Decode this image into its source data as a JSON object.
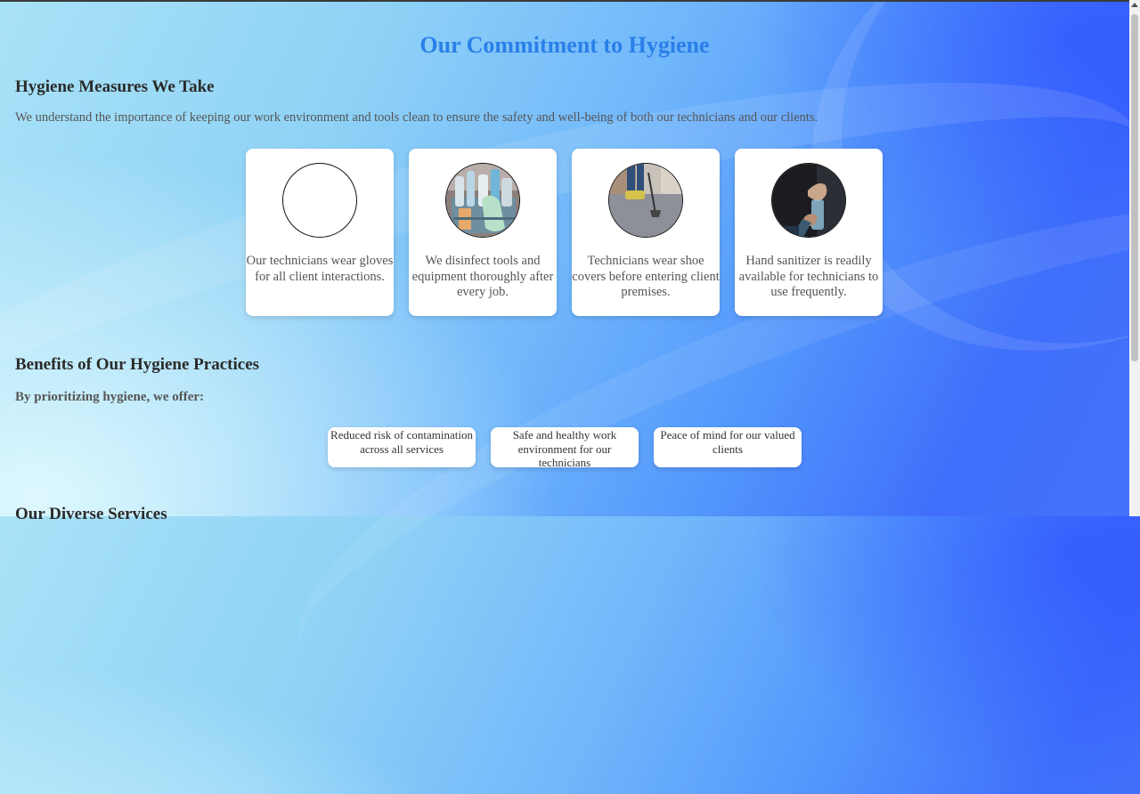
{
  "page": {
    "title": "Our Commitment to Hygiene"
  },
  "measures": {
    "heading": "Hygiene Measures We Take",
    "intro": "We understand the importance of keeping our work environment and tools clean to ensure the safety and well-being of both our technicians and our clients.",
    "cards": [
      {
        "image": "empty-image",
        "text": "Our technicians wear gloves for all client interactions."
      },
      {
        "image": "cleaning-supplies-image",
        "text": "We disinfect tools and equipment thoroughly after every job."
      },
      {
        "image": "carpet-cleaning-image",
        "text": "Technicians wear shoe covers before entering client premises."
      },
      {
        "image": "hand-sanitizer-image",
        "text": "Hand sanitizer is readily available for technicians to use frequently."
      }
    ]
  },
  "benefits": {
    "heading": "Benefits of Our Hygiene Practices",
    "subheading": "By prioritizing hygiene, we offer:",
    "items": [
      "Reduced risk of contamination across all services",
      "Safe and healthy work environment for our technicians",
      "Peace of mind for our valued clients"
    ]
  },
  "services": {
    "heading": "Our Diverse Services"
  },
  "colors": {
    "title": "#2a7fe8",
    "heading": "#2b2b2b",
    "body_text": "#555555"
  }
}
